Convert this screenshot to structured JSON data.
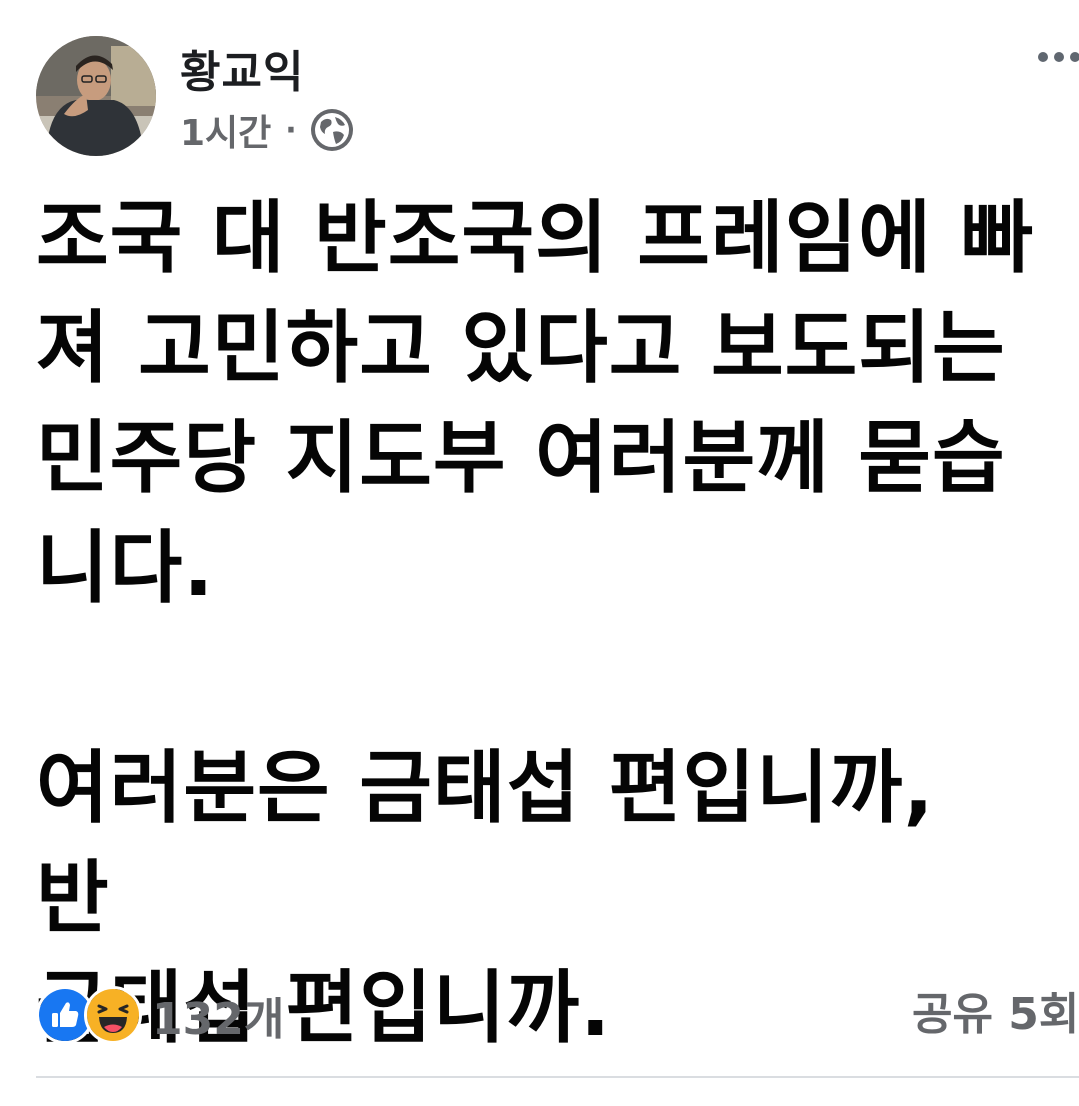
{
  "post": {
    "author": {
      "name": "황교익"
    },
    "time": "1시간",
    "separator": "·",
    "privacy_icon": "globe-icon",
    "more_icon": "more-options-icon",
    "text": {
      "paragraph_1": [
        "조국 대 반조국의 프레임에 빠",
        "져 고민하고 있다고 보도되는",
        "민주당 지도부 여러분께 묻습",
        "니다."
      ],
      "paragraph_2": [
        "여러분은 금태섭 편입니까, 반",
        "금태섭 편입니까."
      ]
    },
    "reactions": {
      "icons": [
        "like-icon",
        "haha-icon"
      ],
      "count": "132개"
    },
    "shares": "공유 5회"
  },
  "colors": {
    "like_blue": "#1877f2",
    "haha_yellow": "#f7b125",
    "meta_gray": "#65676b",
    "divider": "#dadde1"
  }
}
